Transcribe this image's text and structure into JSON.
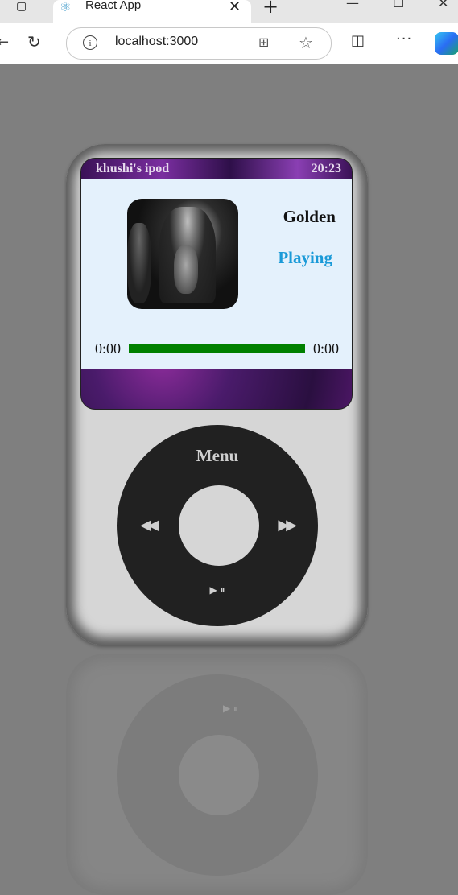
{
  "browser": {
    "tab_title": "React App",
    "url": "localhost:3000",
    "icons": [
      "sidebar-icon",
      "react-favicon",
      "close-icon",
      "new-tab-icon",
      "minimize-icon",
      "maximize-icon",
      "close-window-icon",
      "refresh-icon",
      "info-icon",
      "app-available-icon",
      "favorite-star-icon",
      "split-screen-icon",
      "more-icon",
      "copilot-icon"
    ]
  },
  "ipod": {
    "device_name": "khushi's ipod",
    "clock": "20:23",
    "now_playing": {
      "song_title": "Golden",
      "status": "Playing",
      "current_time": "0:00",
      "duration": "0:00",
      "progress": 1.0
    },
    "wheel": {
      "menu_label": "Menu",
      "prev_icon": "rewind-icon",
      "next_icon": "fast-forward-icon",
      "play_pause_icon": "play-pause-icon"
    },
    "colors": {
      "progress_fill": "#008000",
      "status_text": "#1a9ad8",
      "screen_panel": "#e4f1fc",
      "wheel": "#212121"
    }
  }
}
